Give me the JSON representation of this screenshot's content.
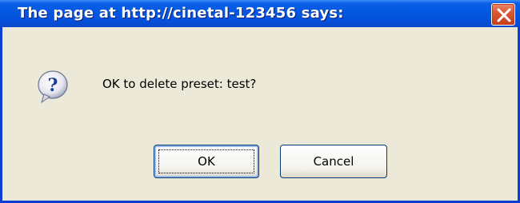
{
  "window": {
    "title": "The page at http://cinetal-123456 says:",
    "close_icon": "close-icon"
  },
  "dialog": {
    "icon": "question-icon",
    "message": "OK to delete preset: test?"
  },
  "buttons": {
    "ok_label": "OK",
    "cancel_label": "Cancel"
  },
  "colors": {
    "titlebar": "#0457e0",
    "dialog_bg": "#ece9d8",
    "close_button": "#d95a35"
  }
}
